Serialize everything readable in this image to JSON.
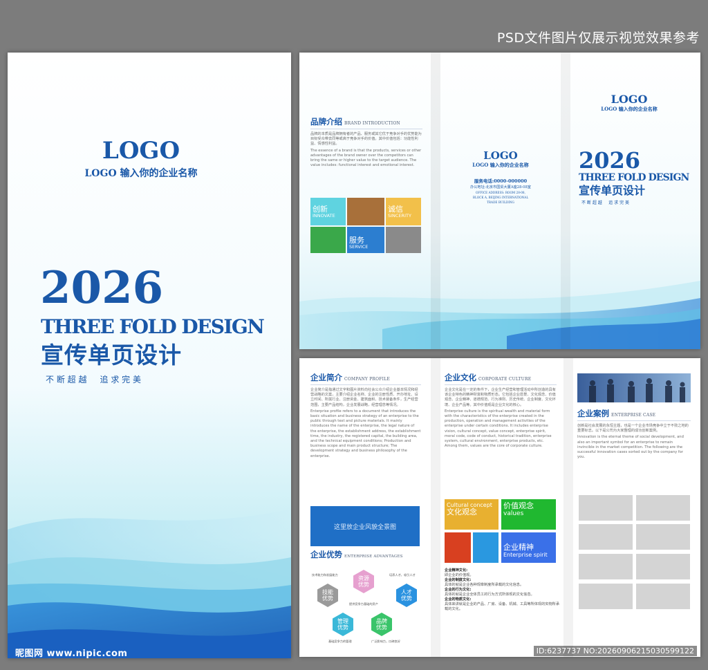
{
  "watermark_top": "PSD文件图片仅展示视觉效果参考",
  "watermark_bottom_id": "ID:6237737 NO:20260906215030599122",
  "watermark_site": "昵图网 www.nipic.com",
  "cover_left": {
    "logo": "LOGO",
    "company": "LOGO 输入你的企业名称",
    "year": "2026",
    "title_en": "THREE FOLD DESIGN",
    "title_cn": "宣传单页设计",
    "slogan": "不 断 超 越     追 求 完 美"
  },
  "outer": {
    "brand": {
      "title_cn": "品牌介绍",
      "title_en": "BRAND INTRODUCTION",
      "para_cn": "品牌的本质是品牌拥有者的产品、服务或其它优于竞争对手的优势能为目标受众带去同等或高于竞争对手的价值。其中价值包括：功能性利益、情感性利益。",
      "para_en": "The essence of a brand is that the products, services or other advantages of the brand owner over the competitors can bring the same or higher value to the target audience. The value includes: functional interest and emotional interest.",
      "tiles": [
        {
          "cn": "创新",
          "en": "INNOVATE"
        },
        {
          "cn": "诚信",
          "en": "SINCERITY"
        },
        {
          "cn": "服务",
          "en": "SERVICE"
        }
      ]
    },
    "back": {
      "logo": "LOGO",
      "company": "LOGO 输入你的企业名称",
      "phone": "服务电话:0000-000000",
      "address_cn": "办公地址:北京市国贸大厦A座28-08室",
      "address_en1": "OFFICE ADDRESS: ROOM 28-08,",
      "address_en2": "BLOCK A, BEIJING INTERNATIONAL",
      "address_en3": "TRADE BUILDING"
    },
    "front": {
      "logo": "LOGO",
      "company": "LOGO 输入你的企业名称",
      "year": "2026",
      "title_en": "THREE FOLD DESIGN",
      "title_cn": "宣传单页设计",
      "slogan": "不 断 超 越     追 求 完 美"
    }
  },
  "inner": {
    "profile": {
      "title_cn": "企业简介",
      "title_en": "COMPANY PROFILE",
      "para_cn": "企业简介是指通过文字和图片资料向社会公众介绍企业基本情况和经营战略的文案，主要介绍企业名称、企业的注册性质、开办地址、设立时间、所属行业、注册资金、建筑面积、技术装备条件，生产经营范围，主要产品结构，企业发展战略，经营理念等情况。",
      "para_en": "Enterprise profile refers to a document that introduces the basic situation and business strategy of an enterprise to the public through text and picture materials. It mainly introduces the name of the enterprise, the legal nature of the enterprise, the establishment address, the establishment time, the industry, the registered capital, the building area, and the technical equipment conditions; Production and business scope and main product structure; The development strategy and business philosophy of the enterprise.",
      "photo_placeholder": "这里放企业风貌全景图"
    },
    "advantages": {
      "title_cn": "企业优势",
      "title_en": "ENTERPRISE ADVANTAGES",
      "hexes": [
        "资源优势",
        "技能优势",
        "人才优势",
        "管理优势",
        "品牌优势"
      ],
      "notes": [
        "技术能力和发展能力",
        "培养人才，吸引人才",
        "提供竞争力基础的资产",
        "基础竞争力的管理",
        "广泛影响力，口碑良好"
      ]
    },
    "culture": {
      "title_cn": "企业文化",
      "title_en": "CORPORATE CULTURE",
      "para_cn": "企业文化是在一定的条件下，企业生产经营和管理活动中所创造的具有该企业特色的精神财富和物质形态。它包括企业愿景、文化观念、价值观念、企业精神、道德规范、行为准则、历史传统、企业制度、文化环境、企业产品等。其中价值观是企业文化的核心。",
      "para_en": "Enterprise culture is the spiritual wealth and material form with the characteristics of the enterprise created in the production, operation and management activities of the enterprise under certain conditions. It includes enterprise vision, cultural concept, value concept, enterprise spirit, moral code, code of conduct, historical tradition, enterprise system, cultural environment, enterprise products, etc. Among them, values are the core of corporate culture.",
      "tiles": [
        {
          "en": "Cultural concept",
          "cn": "文化观念"
        },
        {
          "cn": "价值观念",
          "en": "values"
        },
        {
          "cn": "企业精神",
          "en": "Enterprise spirit"
        }
      ],
      "items": [
        {
          "label": "企业精神文化:",
          "text": "即企业的价值观。"
        },
        {
          "label": "企业的制度文化:",
          "text": "具体的就是企业各种规章制度所承载的文化信息。"
        },
        {
          "label": "企业的行为文化:",
          "text": "具体的就是企业全体员工的行为方式所体现的文化信息。"
        },
        {
          "label": "企业的物质文化:",
          "text": "具体来讲就是企业的产品、厂房、设备、机械、工具等所体现的实物所承载的文化。"
        }
      ]
    },
    "cases": {
      "title_cn": "企业案例",
      "title_en": "ENTERPRISE CASE",
      "para_cn": "创新是社会发展的永恒主题，也是一个企业市场竞争中立于不败之地的重要标志。以下是公司为大家整理的成功创新案例。",
      "para_en": "Innovation is the eternal theme of social development, and also an important symbol for an enterprise to remain invincible in the market competition. The following are the successful innovation cases sorted out by the company for you."
    }
  },
  "colors": {
    "brand_blue": "#1a58a8",
    "cyan": "#5fd3e0",
    "brown": "#a8703a",
    "yellow": "#f2c04a",
    "green": "#3aa84a",
    "blue_tile": "#2c7ed0",
    "gray_tile": "#8a8a8a",
    "red": "#d84020",
    "sky": "#2a98e0",
    "bright_green": "#20b830",
    "royal_blue": "#3a70e8",
    "mustard": "#e8b030"
  }
}
